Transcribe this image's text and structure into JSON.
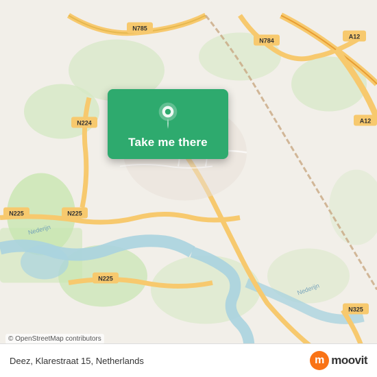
{
  "map": {
    "attribution": "© OpenStreetMap contributors",
    "center_lat": 51.97,
    "center_lon": 5.66
  },
  "popup": {
    "label": "Take me there",
    "pin_icon": "location-pin"
  },
  "bottom_bar": {
    "address": "Deez, Klarestraat 15, Netherlands",
    "logo_text": "moovit",
    "logo_icon": "m"
  }
}
